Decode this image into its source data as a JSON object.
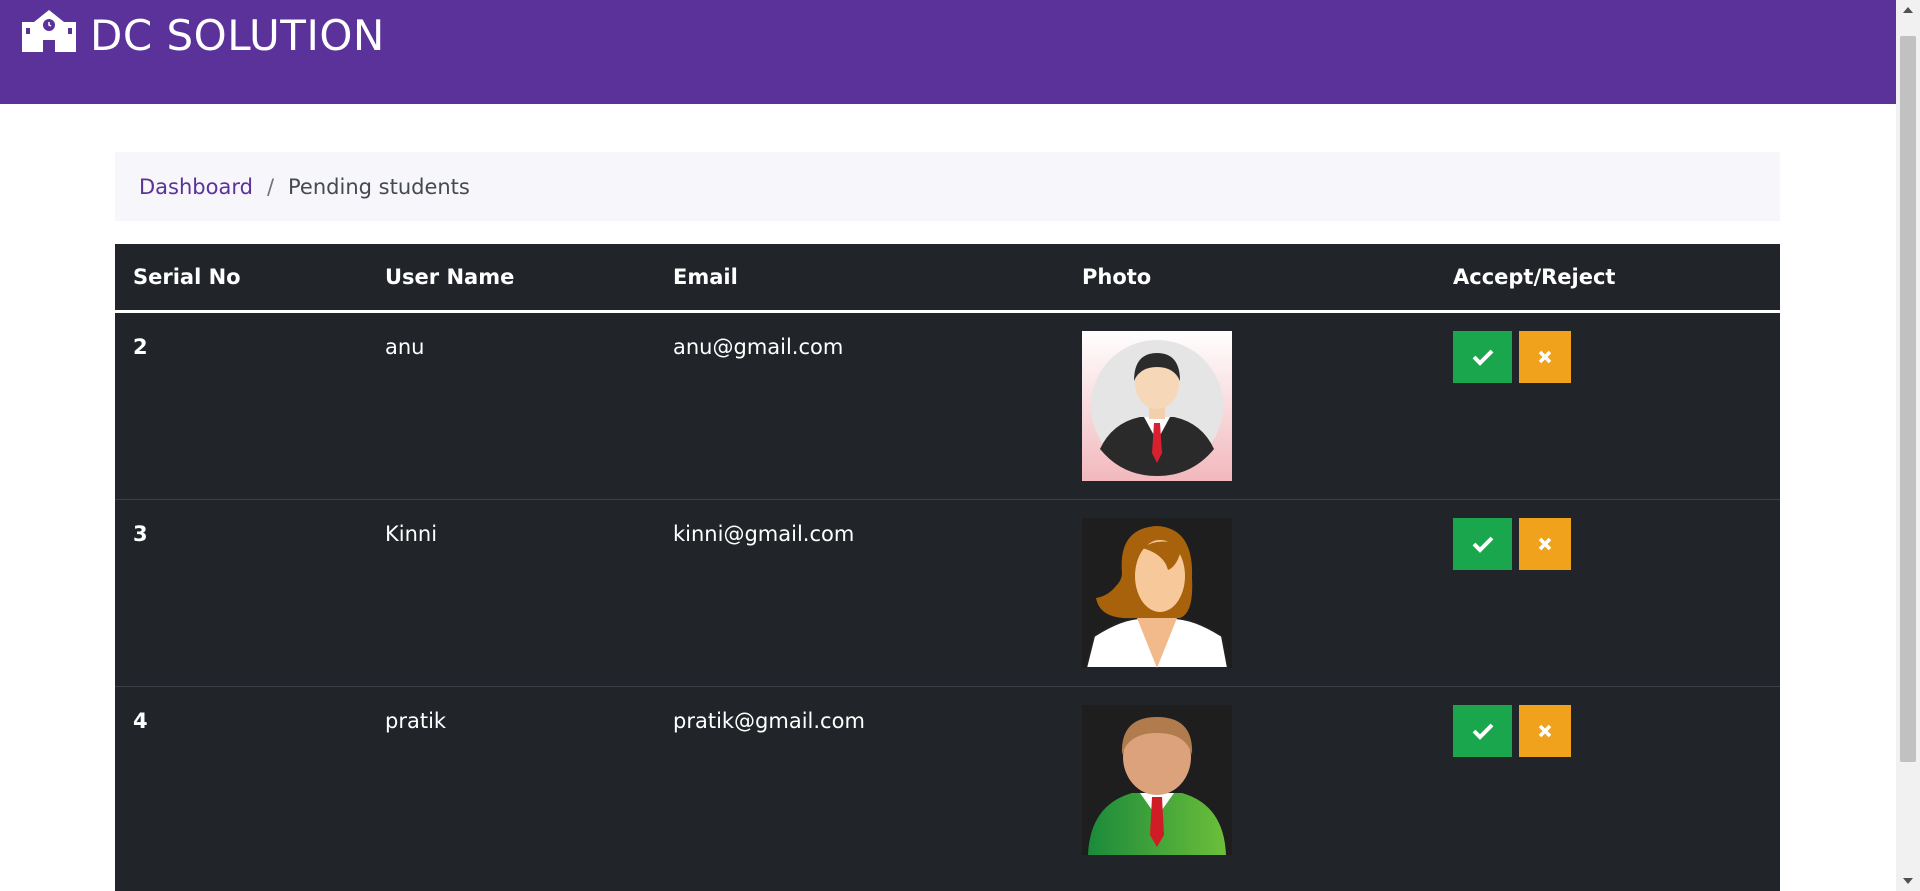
{
  "brand": {
    "name": "DC SOLUTION",
    "icon": "school-icon"
  },
  "breadcrumb": {
    "home": "Dashboard",
    "separator": "/",
    "current": "Pending students"
  },
  "table": {
    "headers": [
      "Serial No",
      "User Name",
      "Email",
      "Photo",
      "Accept/Reject"
    ],
    "rows": [
      {
        "serial": "2",
        "username": "anu",
        "email": "anu@gmail.com",
        "photo": "male-suit-avatar"
      },
      {
        "serial": "3",
        "username": "Kinni",
        "email": "kinni@gmail.com",
        "photo": "female-avatar"
      },
      {
        "serial": "4",
        "username": "pratik",
        "email": "pratik@gmail.com",
        "photo": "male-green-avatar"
      }
    ]
  },
  "colors": {
    "navbar": "#5b3299",
    "table_bg": "#212529",
    "accept": "#1aa64d",
    "reject": "#f0a21d"
  }
}
